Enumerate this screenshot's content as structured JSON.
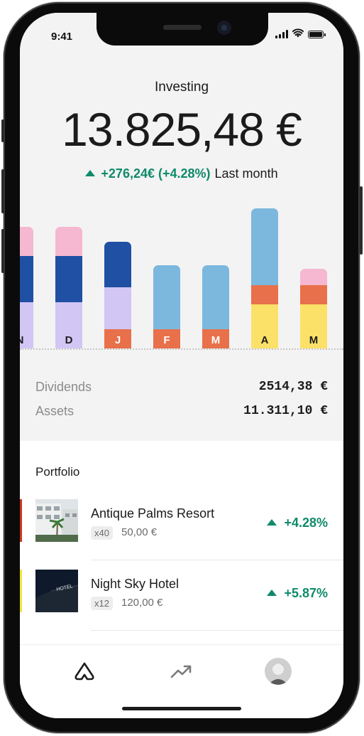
{
  "status_bar": {
    "time": "9:41"
  },
  "header": {
    "title": "Investing",
    "total": "13.825,48 €",
    "change": "+276,24€ (+4.28%)",
    "period": "Last month"
  },
  "colors": {
    "pink": "#f5b8d0",
    "dark_blue": "#1f50a3",
    "lavender": "#d2c6f4",
    "orange": "#e8704a",
    "light_blue": "#7cb8de",
    "yellow": "#fbe168",
    "positive": "#0f8a6a"
  },
  "chart_data": {
    "type": "bar",
    "stacked": true,
    "categories": [
      "N",
      "D",
      "J",
      "F",
      "M",
      "A",
      "M"
    ],
    "bars": [
      {
        "label": "N",
        "segments": [
          {
            "color": "lavender",
            "value": 65
          },
          {
            "color": "dark_blue",
            "value": 65
          },
          {
            "color": "pink",
            "value": 41
          }
        ]
      },
      {
        "label": "D",
        "segments": [
          {
            "color": "lavender",
            "value": 65
          },
          {
            "color": "dark_blue",
            "value": 65
          },
          {
            "color": "pink",
            "value": 41
          }
        ]
      },
      {
        "label": "J",
        "segments": [
          {
            "color": "orange",
            "value": 27
          },
          {
            "color": "lavender",
            "value": 59
          },
          {
            "color": "dark_blue",
            "value": 64
          }
        ]
      },
      {
        "label": "F",
        "segments": [
          {
            "color": "orange",
            "value": 27
          },
          {
            "color": "light_blue",
            "value": 90
          }
        ]
      },
      {
        "label": "M",
        "segments": [
          {
            "color": "orange",
            "value": 27
          },
          {
            "color": "light_blue",
            "value": 90
          }
        ]
      },
      {
        "label": "A",
        "segments": [
          {
            "color": "yellow",
            "value": 62
          },
          {
            "color": "orange",
            "value": 27
          },
          {
            "color": "light_blue",
            "value": 108
          }
        ]
      },
      {
        "label": "M",
        "segments": [
          {
            "color": "yellow",
            "value": 62
          },
          {
            "color": "orange",
            "value": 27
          },
          {
            "color": "pink",
            "value": 23
          }
        ]
      }
    ]
  },
  "metrics": {
    "dividends_label": "Dividends",
    "dividends_value": "2514,38 €",
    "assets_label": "Assets",
    "assets_value": "11.311,10 €"
  },
  "portfolio": {
    "heading": "Portfolio",
    "items": [
      {
        "name": "Antique Palms Resort",
        "qty": "x40",
        "price": "50,00 €",
        "change": "+4.28%",
        "accent": "#c43a1f"
      },
      {
        "name": "Night Sky Hotel",
        "qty": "x12",
        "price": "120,00 €",
        "change": "+5.87%",
        "accent": "#f2e53a"
      }
    ]
  },
  "tab_bar": {
    "items": [
      {
        "icon": "home-icon"
      },
      {
        "icon": "trend-up-icon"
      },
      {
        "icon": "avatar"
      }
    ]
  }
}
